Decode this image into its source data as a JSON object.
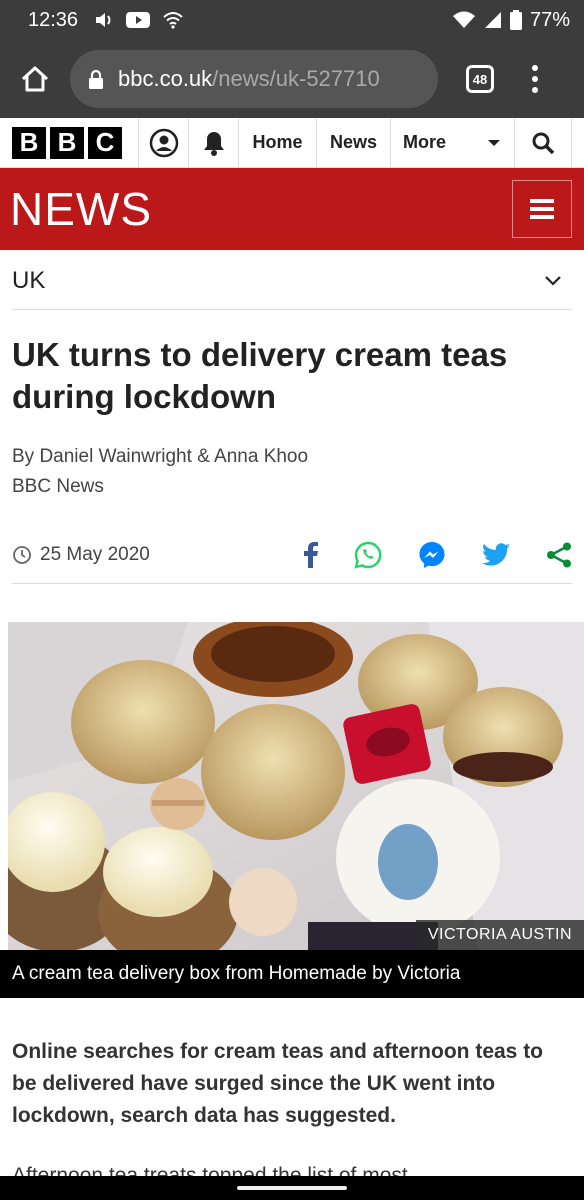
{
  "status_bar": {
    "time": "12:36",
    "battery": "77%"
  },
  "browser": {
    "url_domain": "bbc.co.uk",
    "url_path": "/news/uk-527710",
    "tab_count": "48"
  },
  "nav": {
    "logo_letters": [
      "B",
      "B",
      "C"
    ],
    "home": "Home",
    "news": "News",
    "more": "More"
  },
  "banner": {
    "title": "NEWS"
  },
  "section": {
    "label": "UK"
  },
  "article": {
    "headline": "UK turns to delivery cream teas during lockdown",
    "byline": "By Daniel Wainwright & Anna Khoo",
    "source": "BBC News",
    "date": "25 May 2020",
    "image_credit": "VICTORIA AUSTIN",
    "caption": "A cream tea delivery box from Homemade by Victoria",
    "intro": "Online searches for cream teas and afternoon teas to be delivered have surged since the UK went into lockdown, search data has suggested.",
    "body_partial": "Afternoon tea treats topped the list of most"
  },
  "colors": {
    "bbc_red": "#bb1919",
    "facebook": "#3b5998",
    "whatsapp": "#25d366",
    "messenger": "#0084ff",
    "twitter": "#1da1f2",
    "share": "#0a8b35"
  },
  "icons": [
    "volume-icon",
    "youtube-icon",
    "wifi-icon",
    "signal-icon",
    "battery-icon",
    "home-icon",
    "lock-icon",
    "account-icon",
    "bell-icon",
    "search-icon",
    "chevron-down-icon",
    "clock-icon",
    "facebook-icon",
    "whatsapp-icon",
    "messenger-icon",
    "twitter-icon",
    "share-icon",
    "hamburger-icon"
  ]
}
